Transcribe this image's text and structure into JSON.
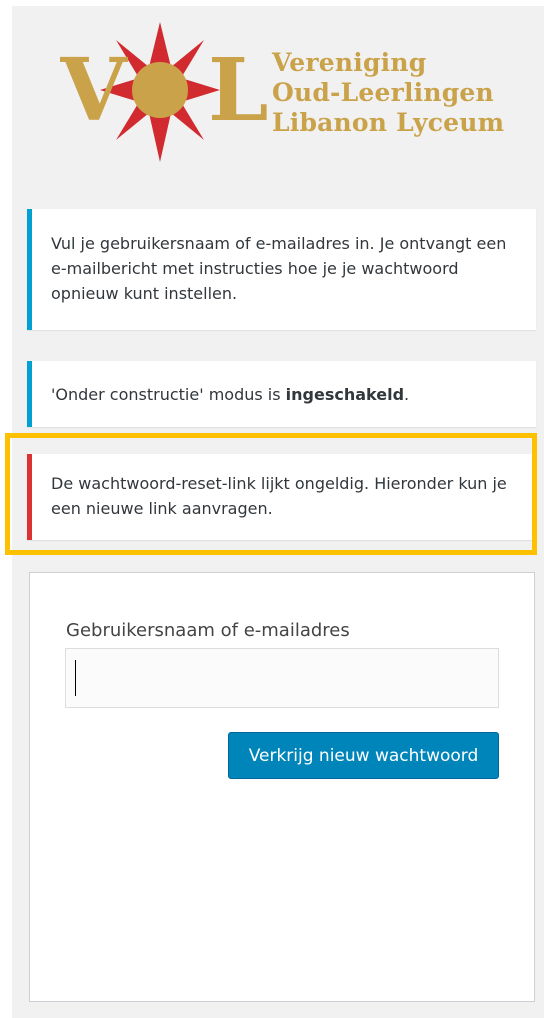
{
  "logo": {
    "monogram": "VOL",
    "line1": "Vereniging",
    "line2": "Oud-Leerlingen",
    "line3": "Libanon Lyceum",
    "colors": {
      "gold": "#c9a24a",
      "star_red": "#d12b30"
    }
  },
  "notices": {
    "intro": "Vul je gebruikersnaam of e-mailadres in. Je ontvangt een e-mailbericht met instructies hoe je je wachtwoord opnieuw kunt instellen.",
    "maintenance_prefix": "'Onder constructie' modus is ",
    "maintenance_status": "ingeschakeld",
    "maintenance_suffix": ".",
    "error": "De wachtwoord-reset-link lijkt ongeldig. Hieronder kun je een nieuwe link aanvragen."
  },
  "form": {
    "username_label": "Gebruikersnaam of e-mailadres",
    "username_value": "",
    "submit_label": "Verkrijg nieuw wachtwoord"
  },
  "colors": {
    "info_border": "#00a0d2",
    "error_border": "#dc3232",
    "highlight": "#ffc000",
    "button": "#0085ba"
  }
}
